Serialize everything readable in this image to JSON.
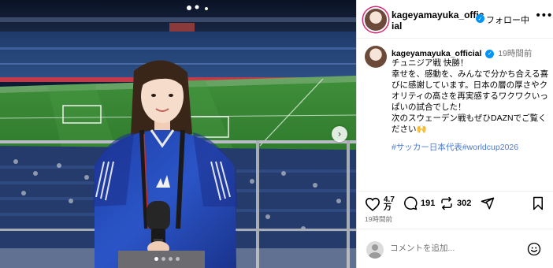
{
  "header": {
    "username": "kageyamayuka_official",
    "follow_status": "フォロー中",
    "more_label": "•••"
  },
  "post": {
    "username": "kageyamayuka_official",
    "time": "19時間前",
    "caption": "チュニジア戦 快勝！\n幸せを、感動を、みんなで分かち合える喜びに感謝しています。日本の層の厚さやクオリティの高さを再実感するワクワクいっぱいの試合でした！\n次のスウェーデン戦もぜひDAZNでご覧ください🙌",
    "hashtags": "#サッカー日本代表#worldcup2026"
  },
  "actions": {
    "likes": "4.7\n万",
    "comments": "191",
    "reposts": "302"
  },
  "timestamp": "19時間前",
  "comment": {
    "placeholder": "コメントを追加..."
  },
  "photo": {
    "carousel_next_icon": "chevron-right-icon",
    "slide_count": 4,
    "active_slide": 1
  },
  "colors": {
    "verified": "#0095f6",
    "hashtag": "#4a7bd3",
    "story_ring": "#d62976",
    "muted_text": "#737373"
  }
}
